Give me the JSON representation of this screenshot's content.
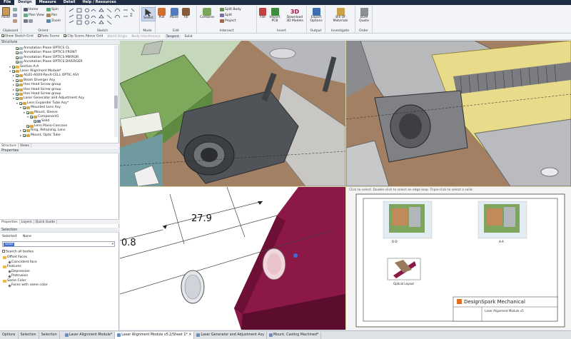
{
  "menubar": {
    "tabs": [
      "File",
      "Design",
      "Measure",
      "Detail",
      "Help / Resources"
    ],
    "active": 1
  },
  "ribbon": {
    "groups": {
      "clipboard": "Clipboard",
      "orient": "Orient",
      "sketch": "Sketch",
      "mode": "Mode",
      "edit": "Edit",
      "intersect": "Intersect",
      "insert": "Insert",
      "output": "Output",
      "investigate": "Investigate",
      "order": "Order"
    },
    "clipboard": {
      "paste": "Paste"
    },
    "orient": {
      "home": "Home",
      "plan_view": "Plan View",
      "spin": "Spin",
      "pan": "Pan",
      "zoom": "Zoom"
    },
    "mode": {
      "select": "Select"
    },
    "edit": {
      "pull": "Pull",
      "move": "Move",
      "fill": "Fill"
    },
    "intersect": {
      "combine": "Combine",
      "split_body": "Split Body",
      "split": "Split",
      "project": "Project"
    },
    "insert": {
      "file": "File",
      "import_pcb": "Import PCB",
      "download_3d": "Download 3D Models",
      "badge_3d": "3D"
    },
    "output": {
      "export_options": "Export Options"
    },
    "investigate": {
      "bill_of_materials": "Bill Of Materials"
    },
    "order": {
      "bom_quote": "BOM Quote"
    }
  },
  "optionbar": {
    "show_sketch_grid": "Show Sketch Grid",
    "fade_scene": "Fade Scene",
    "clip_scene": "Clip Scene Above Grid",
    "world_origin": "World Origin",
    "body_interference": "Body Interference",
    "tangent": "Tangent",
    "solid": "Solid"
  },
  "structure": {
    "title": "Structure",
    "rows": [
      {
        "label": "Annotation Plane OPTICS CL",
        "indent": 3,
        "exp": "",
        "kind": "plane"
      },
      {
        "label": "Annotation Plane OPTICS FRONT",
        "indent": 3,
        "exp": "",
        "kind": "plane"
      },
      {
        "label": "Annotation Plane OPTICS MIRROR",
        "indent": 3,
        "exp": "",
        "kind": "plane"
      },
      {
        "label": "Annotation Plane OPTICS DIVERGER",
        "indent": 3,
        "exp": "",
        "kind": "plane"
      },
      {
        "label": "Section A-A",
        "indent": 2,
        "exp": "-",
        "kind": "folder"
      },
      {
        "label": "Laser Alignment Module*",
        "indent": 2,
        "exp": "-",
        "kind": "comp"
      },
      {
        "label": "AG01-A0XX-RevX-CELL OPTIC ASY",
        "indent": 3,
        "exp": "+",
        "kind": "comp"
      },
      {
        "label": "Beam Diverger Asy",
        "indent": 3,
        "exp": "+",
        "kind": "comp"
      },
      {
        "label": "Hex Head Screw group",
        "indent": 3,
        "exp": "+",
        "kind": "comp"
      },
      {
        "label": "Hex Head Screw group",
        "indent": 3,
        "exp": "+",
        "kind": "comp"
      },
      {
        "label": "Hex Head Screw group",
        "indent": 3,
        "exp": "+",
        "kind": "comp"
      },
      {
        "label": "Laser Generator and Adjustment Asy",
        "indent": 3,
        "exp": "-",
        "kind": "comp"
      },
      {
        "label": "Lens Expander Tube Asy*",
        "indent": 4,
        "exp": "-",
        "kind": "comp"
      },
      {
        "label": "Mounted Lens Asy",
        "indent": 5,
        "exp": "-",
        "kind": "comp"
      },
      {
        "label": "Mount, Sleeve",
        "indent": 6,
        "exp": "-",
        "kind": "comp"
      },
      {
        "label": "Component1",
        "indent": 7,
        "exp": "-",
        "kind": "comp"
      },
      {
        "label": "Solid",
        "indent": 8,
        "exp": "",
        "kind": "solid"
      },
      {
        "label": "Lens Plano-Concave",
        "indent": 6,
        "exp": "",
        "kind": "comp"
      },
      {
        "label": "Ring, Retaining, Lens",
        "indent": 5,
        "exp": "+",
        "kind": "comp"
      },
      {
        "label": "Mount, Optic Tube",
        "indent": 5,
        "exp": "+",
        "kind": "comp"
      }
    ]
  },
  "left_tabs_top": [
    "Structure",
    "Views"
  ],
  "properties": {
    "title": "Properties"
  },
  "left_tabs_mid": [
    "Properties",
    "Layers",
    "Quick Guide"
  ],
  "selection": {
    "title": "Selection",
    "selected_label": "Selected:",
    "selected_value": "None",
    "search_value": "Solid",
    "search_all": "Search all bodies",
    "groups": [
      {
        "label": "Offset Faces",
        "items": [
          "Coincident face"
        ]
      },
      {
        "label": "Features",
        "items": [
          "Depression",
          "Protrusion"
        ]
      },
      {
        "label": "Same Color",
        "items": [
          "Faces with same color"
        ]
      }
    ]
  },
  "viewports": {
    "dimension_1": "0.8",
    "dimension_2": "27.9",
    "hint": "Click to select. Double-click to select an edge loop. Triple-click to select a solid.",
    "drawing": {
      "section_label": "A-A",
      "view_label": "D-D",
      "iso_label": "Optical Layout",
      "title_brand": "DesignSpark Mechanical",
      "title_doc": "Laser Alignment Module v5"
    }
  },
  "statusbar": {
    "tabs": [
      "Options",
      "Selection",
      "Selection"
    ],
    "docs": [
      "Laser Alignment Module*",
      "Laser Alignment Module v5.2/Sheet 1* ×",
      "Laser Generator and Adjustment Asy",
      "Mount, Casting Machined*"
    ]
  },
  "colors": {
    "accent": "#1f2d45",
    "highlight": "#3d6fd6",
    "magenta": "#8c1848",
    "tan": "#9a7a5c",
    "green": "#6f9a4a"
  }
}
